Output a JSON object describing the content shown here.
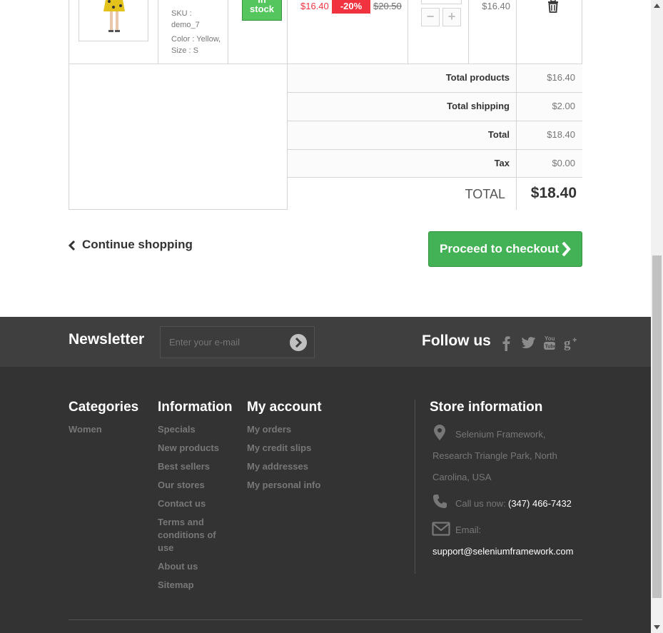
{
  "cart_item": {
    "sku_label": "SKU :",
    "sku_value": "demo_7",
    "color_label": "Color : Yellow,",
    "size_label": "Size : S",
    "availability_line1": "In",
    "availability_line2": "stock",
    "price": "$16.40",
    "discount": "-20%",
    "old_price": "$20.50",
    "minus": "−",
    "plus": "+",
    "total": "$16.40"
  },
  "totals": {
    "rows": [
      {
        "label": "Total products",
        "value": "$16.40"
      },
      {
        "label": "Total shipping",
        "value": "$2.00"
      },
      {
        "label": "Total",
        "value": "$18.40"
      },
      {
        "label": "Tax",
        "value": "$0.00"
      }
    ],
    "grand_label": "TOTAL",
    "grand_value": "$18.40"
  },
  "actions": {
    "continue_label": "Continue shopping",
    "checkout_label": "Proceed to checkout"
  },
  "newsletter": {
    "title": "Newsletter",
    "placeholder": "Enter your e-mail",
    "follow_title": "Follow us"
  },
  "footer": {
    "categories": {
      "title": "Categories",
      "items": [
        "Women"
      ]
    },
    "information": {
      "title": "Information",
      "items": [
        "Specials",
        "New products",
        "Best sellers",
        "Our stores",
        "Contact us",
        "Terms and conditions of use",
        "About us",
        "Sitemap"
      ]
    },
    "account": {
      "title": "My account",
      "items": [
        "My orders",
        "My credit slips",
        "My addresses",
        "My personal info"
      ]
    },
    "store": {
      "title": "Store information",
      "address_line1": "Selenium Framework,",
      "address_line2": "Research Triangle Park, North",
      "address_line3": "Carolina, USA",
      "call_label": "Call us now:",
      "phone": "(347) 466-7432",
      "email_label": "Email:",
      "email": "support@seleniumframework.com"
    }
  },
  "colors": {
    "checkout_green": "#43b155",
    "price_red": "#f13340",
    "footer_bg": "#333333"
  }
}
